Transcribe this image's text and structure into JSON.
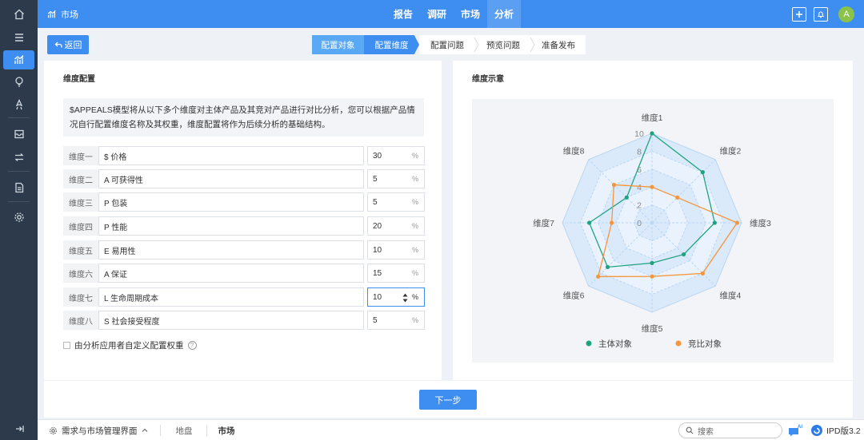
{
  "topbar": {
    "crumb_label": "市场",
    "nav": [
      {
        "label": "报告",
        "active": false
      },
      {
        "label": "调研",
        "active": false
      },
      {
        "label": "市场",
        "active": false
      },
      {
        "label": "分析",
        "active": true
      }
    ],
    "avatar_letter": "A"
  },
  "back_label": "返回",
  "steps": [
    "配置对象",
    "配置维度",
    "配置问题",
    "预览问题",
    "准备发布"
  ],
  "left": {
    "title": "维度配置",
    "description": "$APPEALS模型将从以下多个维度对主体产品及其竞对产品进行对比分析，您可以根据产品情况自行配置维度名称及其权重，维度配置将作为后续分析的基础结构。",
    "rows": [
      {
        "label": "维度一",
        "name": "$ 价格",
        "weight": "30"
      },
      {
        "label": "维度二",
        "name": "A 可获得性",
        "weight": "5"
      },
      {
        "label": "维度三",
        "name": "P 包装",
        "weight": "5"
      },
      {
        "label": "维度四",
        "name": "P 性能",
        "weight": "20"
      },
      {
        "label": "维度五",
        "name": "E 易用性",
        "weight": "10"
      },
      {
        "label": "维度六",
        "name": "A 保证",
        "weight": "15"
      },
      {
        "label": "维度七",
        "name": "L 生命周期成本",
        "weight": "10"
      },
      {
        "label": "维度八",
        "name": "S 社会接受程度",
        "weight": "5"
      }
    ],
    "unit": "%",
    "custom_label": "由分析应用者自定义配置权重",
    "help_glyph": "?"
  },
  "right": {
    "title": "维度示意"
  },
  "chart_data": {
    "type": "radar",
    "axes": [
      "维度1",
      "维度2",
      "维度3",
      "维度4",
      "维度5",
      "维度6",
      "维度7",
      "维度8"
    ],
    "ticks": [
      "0",
      "2",
      "4",
      "6",
      "8",
      "10"
    ],
    "range": [
      0,
      10
    ],
    "series": [
      {
        "name": "主体对象",
        "color": "#1fa37f",
        "values": [
          10,
          8,
          7,
          5,
          4.5,
          7,
          7,
          4
        ]
      },
      {
        "name": "竞比对象",
        "color": "#f5963c",
        "values": [
          4,
          4,
          9.5,
          8,
          6,
          8.5,
          4.5,
          6
        ]
      }
    ],
    "legend": "bottom"
  },
  "next_label": "下一步",
  "bottombar": {
    "workspace": "需求与市场管理界面",
    "items": [
      "地盘",
      "市场"
    ],
    "search_placeholder": "搜索",
    "ai_label": "AI",
    "version": "IPD版3.2"
  },
  "colors": {
    "primary": "#3d8ef0",
    "rail": "#2d3a4b"
  }
}
